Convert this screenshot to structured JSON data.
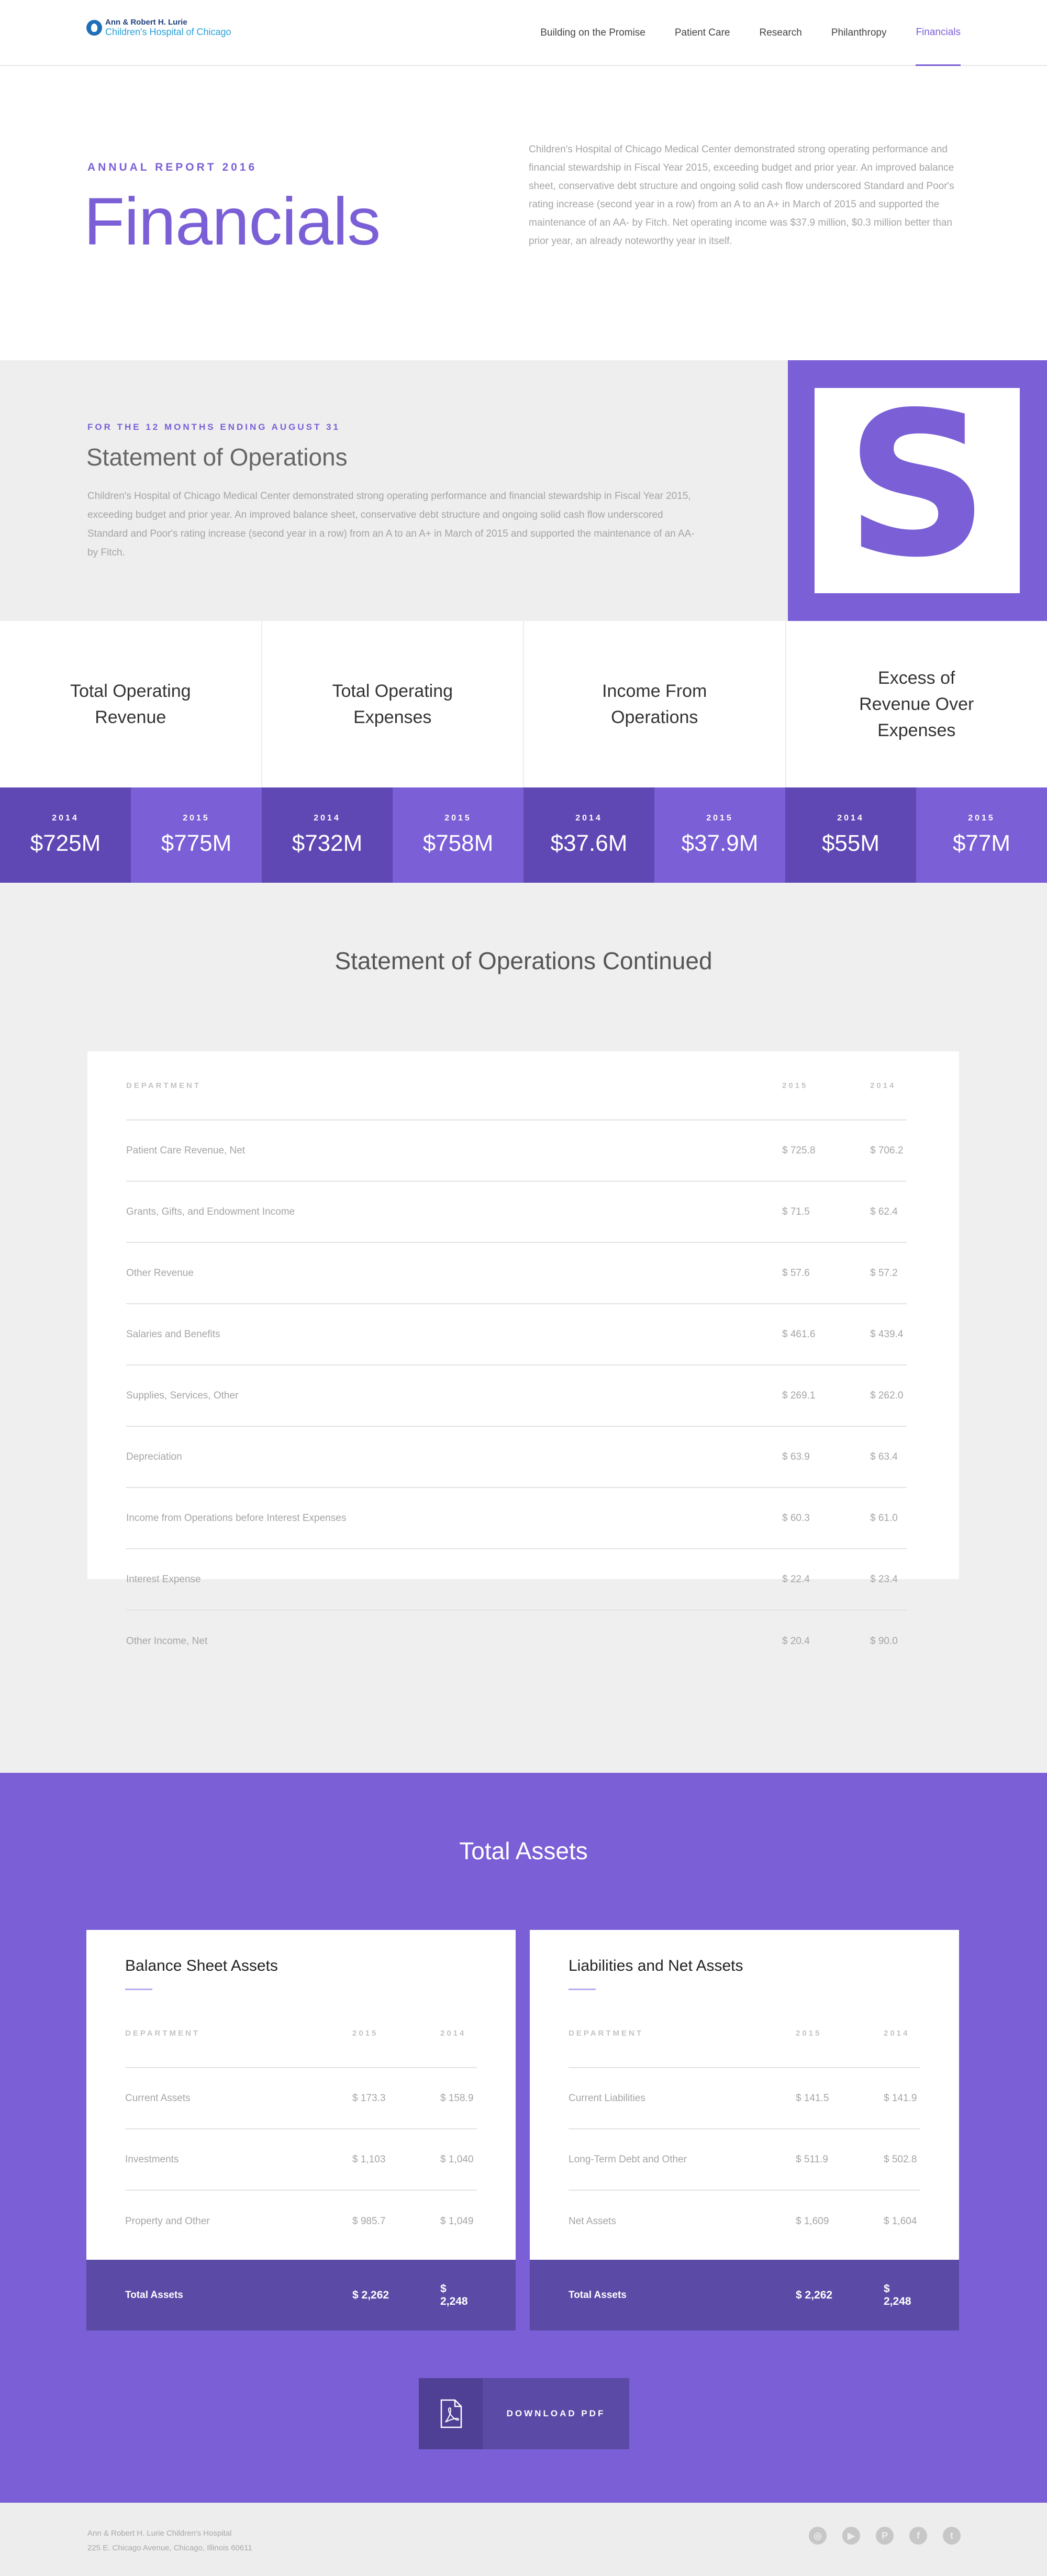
{
  "header": {
    "logo_line1": "Ann & Robert H. Lurie",
    "logo_line2": "Children's Hospital of Chicago",
    "nav": [
      {
        "label": "Building on the Promise"
      },
      {
        "label": "Patient Care"
      },
      {
        "label": "Research"
      },
      {
        "label": "Philanthropy"
      },
      {
        "label": "Financials"
      }
    ],
    "active_nav": "Financials"
  },
  "hero": {
    "eyebrow": "ANNUAL REPORT 2016",
    "title": "Financials",
    "intro": "Children's Hospital of Chicago Medical Center demonstrated strong operating performance and financial stewardship in Fiscal Year 2015, exceeding budget and prior year. An improved balance sheet, conservative debt structure and ongoing solid cash flow underscored Standard and Poor's rating increase (second year in a row) from an A to an A+ in March of 2015 and supported the maintenance of an AA- by Fitch. Net operating income was $37.9 million, $0.3 million better than prior year, an already noteworthy year in itself."
  },
  "operations": {
    "eyebrow": "FOR THE 12 MONTHS ENDING AUGUST 31",
    "title": "Statement of Operations",
    "text": "Children's Hospital of Chicago Medical Center demonstrated strong operating performance and financial stewardship in Fiscal Year 2015, exceeding budget and prior year. An improved balance sheet, conservative debt structure and ongoing solid cash flow underscored Standard and Poor's rating increase (second year in a row) from an A to an A+ in March of 2015 and supported the maintenance of an AA- by Fitch.",
    "badge_letter": "S",
    "accent_color": "#7a5fd6"
  },
  "metrics": [
    {
      "label": "Total Operating Revenue",
      "y1": "2014",
      "v1": "$725M",
      "y2": "2015",
      "v2": "$775M"
    },
    {
      "label": "Total Operating Expenses",
      "y1": "2014",
      "v1": "$732M",
      "y2": "2015",
      "v2": "$758M"
    },
    {
      "label": "Income From Operations",
      "y1": "2014",
      "v1": "$37.6M",
      "y2": "2015",
      "v2": "$37.9M"
    },
    {
      "label": "Excess of Revenue Over Expenses",
      "y1": "2014",
      "v1": "$55M",
      "y2": "2015",
      "v2": "$77M"
    }
  ],
  "continued": {
    "title": "Statement of Operations Continued",
    "headers": {
      "name": "DEPARTMENT",
      "c1": "2015",
      "c2": "2014"
    },
    "rows": [
      {
        "name": "Patient Care Revenue, Net",
        "c1": "$ 725.8",
        "c2": "$ 706.2"
      },
      {
        "name": "Grants, Gifts, and Endowment Income",
        "c1": "$ 71.5",
        "c2": "$ 62.4"
      },
      {
        "name": "Other Revenue",
        "c1": "$ 57.6",
        "c2": "$ 57.2"
      },
      {
        "name": "Salaries and Benefits",
        "c1": "$ 461.6",
        "c2": "$ 439.4"
      },
      {
        "name": "Supplies, Services, Other",
        "c1": "$ 269.1",
        "c2": "$ 262.0"
      },
      {
        "name": "Depreciation",
        "c1": "$ 63.9",
        "c2": "$ 63.4"
      },
      {
        "name": "Income from Operations before Interest Expenses",
        "c1": "$ 60.3",
        "c2": "$ 61.0"
      },
      {
        "name": "Interest Expense",
        "c1": "$ 22.4",
        "c2": "$ 23.4"
      },
      {
        "name": "Other Income, Net",
        "c1": "$ 20.4",
        "c2": "$ 90.0"
      }
    ]
  },
  "assets": {
    "title": "Total Assets",
    "balance": {
      "title": "Balance Sheet Assets",
      "headers": {
        "name": "DEPARTMENT",
        "c1": "2015",
        "c2": "2014"
      },
      "rows": [
        {
          "name": "Current Assets",
          "c1": "$ 173.3",
          "c2": "$ 158.9"
        },
        {
          "name": "Investments",
          "c1": "$ 1,103",
          "c2": "$ 1,040"
        },
        {
          "name": "Property and Other",
          "c1": "$ 985.7",
          "c2": "$ 1,049"
        }
      ],
      "total": {
        "name": "Total Assets",
        "c1": "$ 2,262",
        "c2": "$ 2,248"
      }
    },
    "liabilities": {
      "title": "Liabilities and Net Assets",
      "headers": {
        "name": "DEPARTMENT",
        "c1": "2015",
        "c2": "2014"
      },
      "rows": [
        {
          "name": "Current Liabilities",
          "c1": "$ 141.5",
          "c2": "$ 141.9"
        },
        {
          "name": "Long-Term Debt and Other",
          "c1": "$ 511.9",
          "c2": "$ 502.8"
        },
        {
          "name": "Net Assets",
          "c1": "$ 1,609",
          "c2": "$ 1,604"
        }
      ],
      "total": {
        "name": "Total Assets",
        "c1": "$ 2,262",
        "c2": "$ 2,248"
      }
    },
    "download_label": "DOWNLOAD PDF"
  },
  "footer": {
    "line1": "Ann & Robert H. Lurie Children's Hospital",
    "line2": "225 E. Chicago Avenue, Chicago, Illinois 60611",
    "social": [
      {
        "icon": "instagram-icon",
        "glyph": "◎"
      },
      {
        "icon": "youtube-icon",
        "glyph": "▶"
      },
      {
        "icon": "pinterest-icon",
        "glyph": "P"
      },
      {
        "icon": "facebook-icon",
        "glyph": "f"
      },
      {
        "icon": "twitter-icon",
        "glyph": "t"
      }
    ]
  }
}
